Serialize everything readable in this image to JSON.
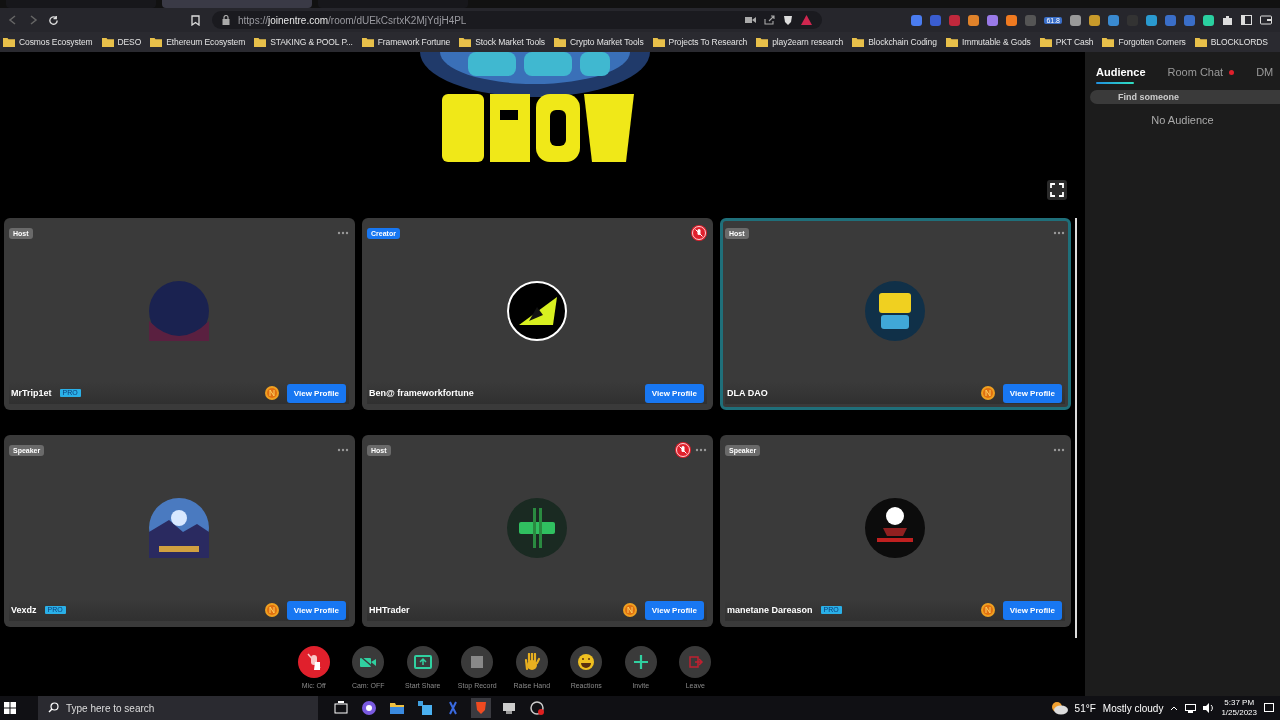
{
  "browser": {
    "tabs": [
      {
        "selected": false
      },
      {
        "selected": true
      },
      {
        "selected": false
      }
    ],
    "url": {
      "scheme": "https://",
      "host": "joinentre.com",
      "path": "/room/dUEkCsrtxK2MjYdjH4PL"
    },
    "extension_badge": "61.8",
    "bookmarks": [
      "Cosmos Ecosystem",
      "DESO",
      "Ethereum Ecosystem",
      "STAKING & POOL P...",
      "Framework Fortune",
      "Stock Market Tools",
      "Crypto Market Tools",
      "Projects To Research",
      "play2earn research",
      "Blockchain Coding",
      "Immutable & Gods",
      "PKT Cash",
      "Forgotten Corners",
      "BLOCKLORDS"
    ]
  },
  "stage": {
    "participants": [
      {
        "role": "Host",
        "name": "MrTrip1et",
        "pro_badge": "PRO",
        "muted": false,
        "coin": true,
        "highlighted": false,
        "menu": true,
        "button": "View Profile"
      },
      {
        "role": "Creator",
        "name": "Ben@ frameworkfortune",
        "muted": true,
        "coin": false,
        "highlighted": false,
        "menu": false,
        "button": "View Profile"
      },
      {
        "role": "Host",
        "name": "DLA DAO",
        "muted": false,
        "coin": true,
        "highlighted": true,
        "menu": true,
        "button": "View Profile"
      },
      {
        "role": "Speaker",
        "name": "Vexdz",
        "pro_badge": "PRO",
        "muted": false,
        "coin": true,
        "highlighted": false,
        "menu": true,
        "button": "View Profile"
      },
      {
        "role": "Host",
        "name": "HHTrader",
        "muted": true,
        "coin": true,
        "highlighted": false,
        "menu": true,
        "button": "View Profile"
      },
      {
        "role": "Speaker",
        "name": "manetane Dareason",
        "pro_badge": "PRO",
        "muted": false,
        "coin": true,
        "highlighted": false,
        "menu": true,
        "button": "View Profile"
      }
    ]
  },
  "side_panel": {
    "tabs": [
      {
        "label": "Audience",
        "selected": true,
        "unread": false
      },
      {
        "label": "Room Chat",
        "selected": false,
        "unread": true
      },
      {
        "label": "DM",
        "selected": false,
        "unread": false
      }
    ],
    "search": {
      "placeholder": "Find someone"
    },
    "empty_text": "No Audience"
  },
  "controls": [
    {
      "kind": "mic",
      "label": "Mic: Off",
      "active": true
    },
    {
      "kind": "cam",
      "label": "Cam: OFF",
      "active": false
    },
    {
      "kind": "share",
      "label": "Start Share",
      "active": false
    },
    {
      "kind": "record",
      "label": "Stop Record",
      "active": false
    },
    {
      "kind": "hand",
      "label": "Raise Hand",
      "active": false
    },
    {
      "kind": "reactions",
      "label": "Reactions",
      "active": false
    },
    {
      "kind": "invite",
      "label": "Invite",
      "active": false
    },
    {
      "kind": "leave",
      "label": "Leave",
      "active": false
    }
  ],
  "taskbar": {
    "search": {
      "placeholder": "Type here to search"
    },
    "temperature": "51°F",
    "weather": "Mostly cloudy",
    "time": "5:37 PM",
    "date": "1/25/2023"
  }
}
